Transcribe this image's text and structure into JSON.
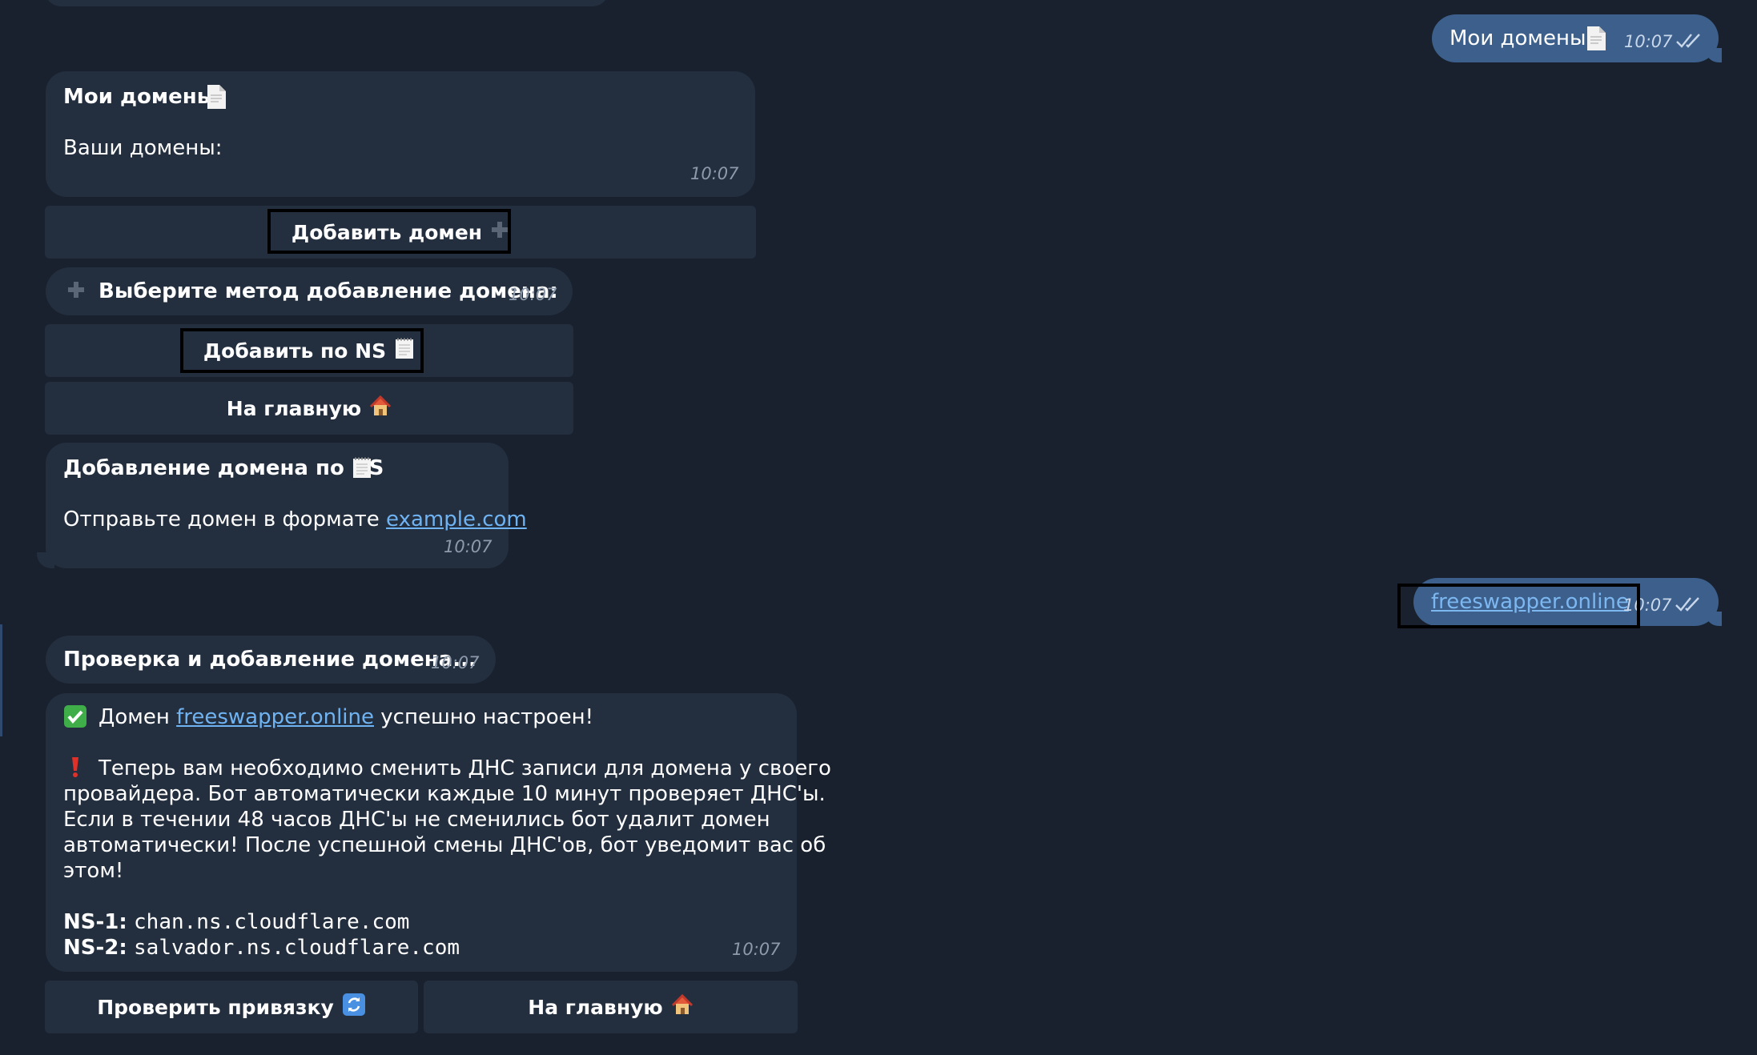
{
  "msg_out_1": {
    "text": "Мои домены",
    "time": "10:07"
  },
  "msg_in_1": {
    "title": "Мои домены",
    "body": "Ваши домены:",
    "time": "10:07"
  },
  "btn_add_domain": {
    "label": "Добавить домен"
  },
  "msg_in_2": {
    "text": "Выберите метод добавление домена:",
    "time": "10:07"
  },
  "btn_add_ns": {
    "label": "Добавить по NS"
  },
  "btn_home_1": {
    "label": "На главную"
  },
  "msg_in_3": {
    "title": "Добавление домена по NS",
    "body": "Отправьте домен в формате",
    "link": "example.com",
    "time": "10:07"
  },
  "msg_out_2": {
    "link": "freeswapper.online",
    "time": "10:07"
  },
  "msg_in_4": {
    "text": "Проверка и добавление домена...",
    "time": "10:07"
  },
  "msg_in_5": {
    "line1_pre": "Домен",
    "line1_link": "freeswapper.online",
    "line1_post": "успешно настроен!",
    "warn_1": "Теперь вам необходимо сменить ДНС записи для домена у своего",
    "warn_2": "провайдера. Бот автоматически каждые 10 минут проверяет ДНС'ы.",
    "warn_3": "Если в течении 48 часов ДНС'ы не сменились бот удалит домен",
    "warn_4": "автоматически! После успешной смены ДНС'ов, бот уведомит вас об",
    "warn_5": "этом!",
    "ns1_label": "NS-1:",
    "ns1_value": "chan.ns.cloudflare.com",
    "ns2_label": "NS-2:",
    "ns2_value": "salvador.ns.cloudflare.com",
    "time": "10:07"
  },
  "btn_check": {
    "label": "Проверить привязку"
  },
  "btn_home_2": {
    "label": "На главную"
  },
  "colors": {
    "background": "#18212d",
    "incoming": "#232f3f",
    "outgoing": "#3c5f8c",
    "link": "#6fb3f2"
  }
}
